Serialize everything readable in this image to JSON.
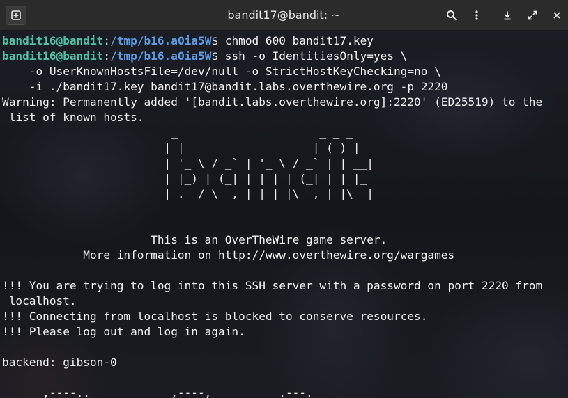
{
  "window": {
    "title": "bandit17@bandit: ~",
    "icons": {
      "new_tab": "new-tab-icon",
      "search": "search-icon",
      "menu": "kebab-menu-icon",
      "download": "download-icon",
      "maximize": "maximize-icon",
      "close": "close-icon"
    }
  },
  "colors": {
    "prompt_user": "#4fc2a6",
    "prompt_path": "#5b9ce6",
    "text": "#f2f2f2",
    "titlebar": "#2b2b2b",
    "background": "#121418"
  },
  "terminal": {
    "lines": [
      {
        "type": "prompt",
        "user": "bandit16@bandit",
        "sep": ":",
        "path": "/tmp/b16.aOia5W",
        "end": "$",
        "cmd": " chmod 600 bandit17.key"
      },
      {
        "type": "prompt",
        "user": "bandit16@bandit",
        "sep": ":",
        "path": "/tmp/b16.aOia5W",
        "end": "$",
        "cmd": " ssh -o IdentitiesOnly=yes \\"
      },
      {
        "type": "text",
        "text": "    -o UserKnownHostsFile=/dev/null -o StrictHostKeyChecking=no \\"
      },
      {
        "type": "text",
        "text": "    -i ./bandit17.key bandit17@bandit.labs.overthewire.org -p 2220"
      },
      {
        "type": "text",
        "text": "Warning: Permanently added '[bandit.labs.overthewire.org]:2220' (ED25519) to the"
      },
      {
        "type": "text",
        "text": " list of known hosts."
      },
      {
        "type": "text",
        "text": "                         _                     _ _ _"
      },
      {
        "type": "text",
        "text": "                        | |__   __ _ _ __   __| (_) |_"
      },
      {
        "type": "text",
        "text": "                        | '_ \\ / _` | '_ \\ / _` | | __|"
      },
      {
        "type": "text",
        "text": "                        | |_) | (_| | | | | (_| | | |_"
      },
      {
        "type": "text",
        "text": "                        |_.__/ \\__,_|_| |_|\\__,_|_|\\__|"
      },
      {
        "type": "text",
        "text": ""
      },
      {
        "type": "text",
        "text": ""
      },
      {
        "type": "text",
        "text": "                      This is an OverTheWire game server."
      },
      {
        "type": "text",
        "text": "            More information on http://www.overthewire.org/wargames"
      },
      {
        "type": "text",
        "text": ""
      },
      {
        "type": "text",
        "text": "!!! You are trying to log into this SSH server with a password on port 2220 from"
      },
      {
        "type": "text",
        "text": " localhost."
      },
      {
        "type": "text",
        "text": "!!! Connecting from localhost is blocked to conserve resources."
      },
      {
        "type": "text",
        "text": "!!! Please log out and log in again."
      },
      {
        "type": "text",
        "text": ""
      },
      {
        "type": "text",
        "text": "backend: gibson-0"
      },
      {
        "type": "text",
        "text": ""
      },
      {
        "type": "text",
        "text": "      ,----..            ,----,          .---."
      }
    ]
  }
}
